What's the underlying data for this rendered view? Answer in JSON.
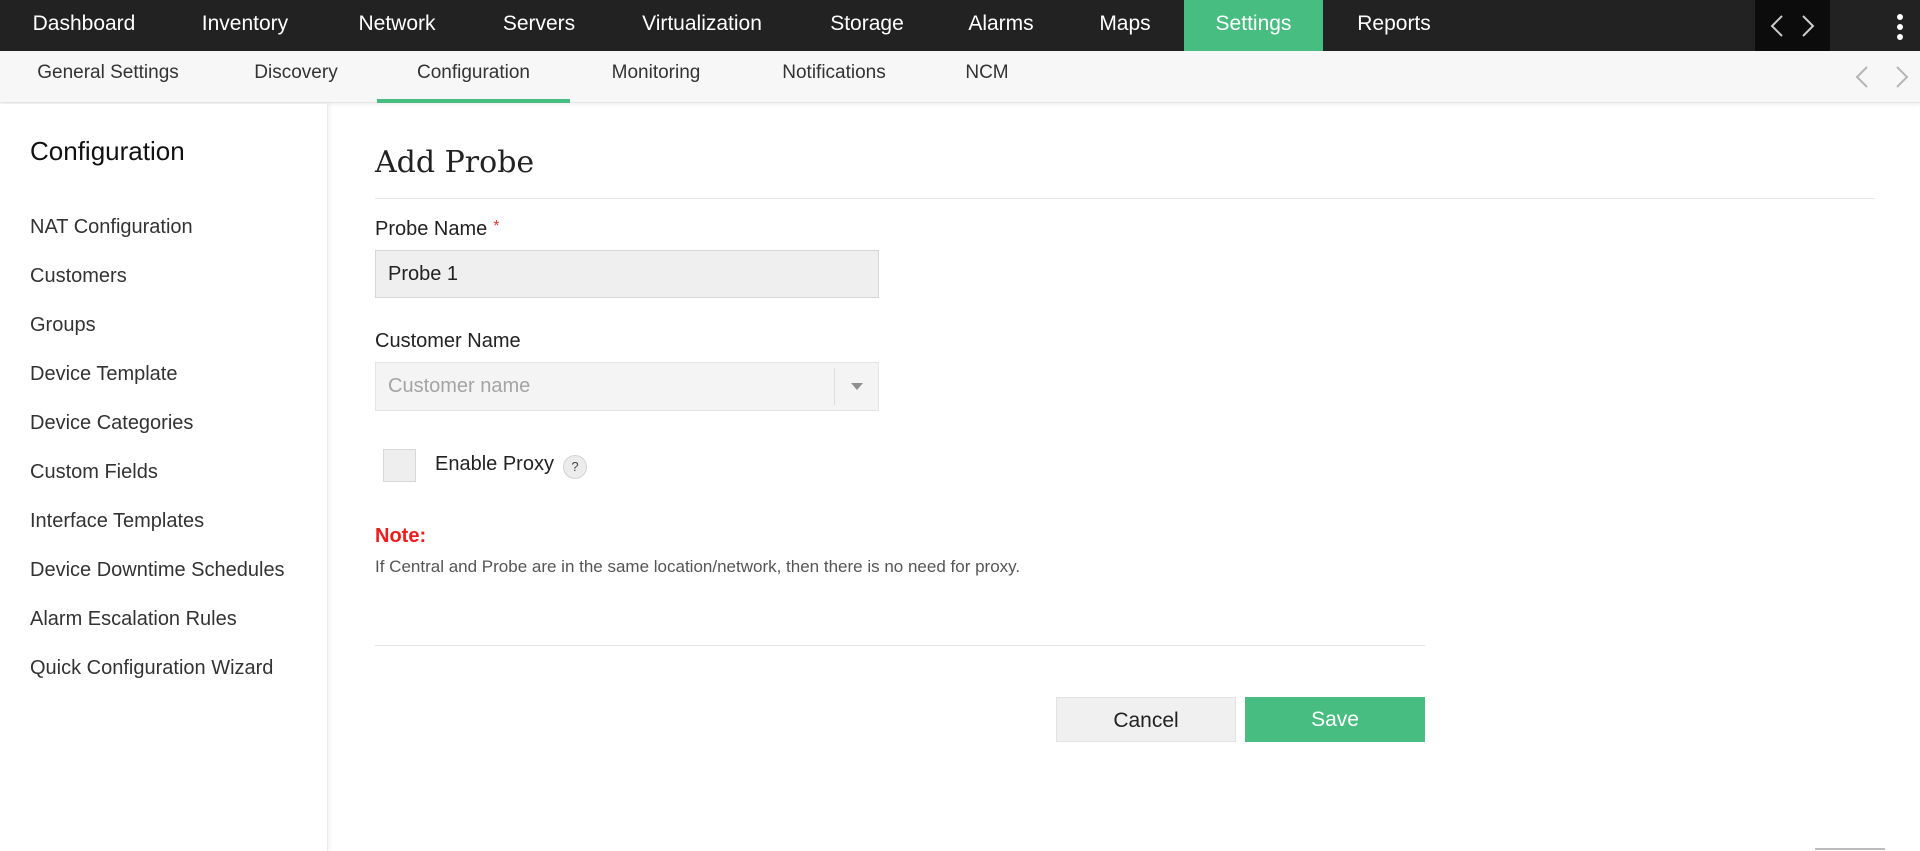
{
  "topnav": {
    "tabs": [
      "Dashboard",
      "Inventory",
      "Network",
      "Servers",
      "Virtualization",
      "Storage",
      "Alarms",
      "Maps",
      "Settings",
      "Reports"
    ],
    "active": "Settings",
    "icons": [
      "chevron-left-icon",
      "chevron-right-icon",
      "more-vertical-icon"
    ]
  },
  "subnav": {
    "tabs": [
      "General Settings",
      "Discovery",
      "Configuration",
      "Monitoring",
      "Notifications",
      "NCM"
    ],
    "active": "Configuration"
  },
  "sidebar": {
    "title": "Configuration",
    "items": [
      "NAT Configuration",
      "Customers",
      "Groups",
      "Device Template",
      "Device Categories",
      "Custom Fields",
      "Interface Templates",
      "Device Downtime Schedules",
      "Alarm Escalation Rules",
      "Quick Configuration Wizard"
    ]
  },
  "form": {
    "title": "Add Probe",
    "probe_name_label": "Probe Name",
    "required_mark": "*",
    "probe_name_value": "Probe 1",
    "customer_name_label": "Customer Name",
    "customer_name_placeholder": "Customer name",
    "enable_proxy_label": "Enable Proxy",
    "help_symbol": "?",
    "note_title": "Note:",
    "note_text": "If Central and Probe are in the same location/network, then there is no need for proxy.",
    "cancel_label": "Cancel",
    "save_label": "Save"
  },
  "colors": {
    "accent": "#48bd81",
    "topbar": "#222222",
    "note": "#ee1c1c"
  }
}
